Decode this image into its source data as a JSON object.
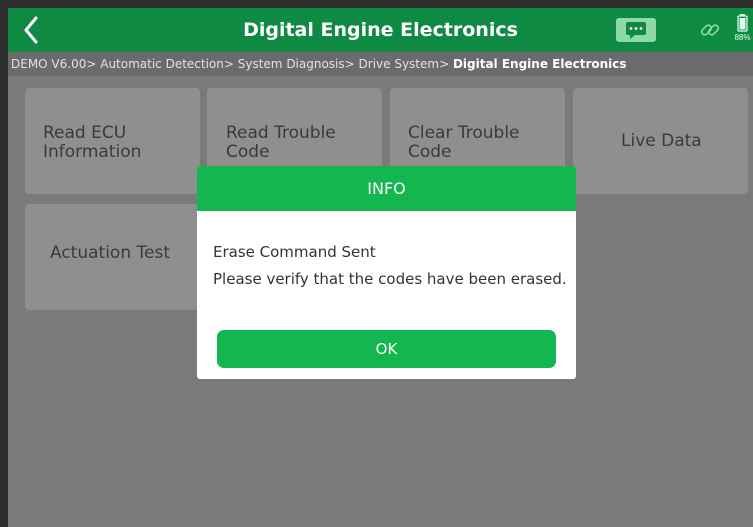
{
  "header": {
    "title": "Digital Engine Electronics",
    "back_icon": "chevron-left-icon",
    "message_icon": "message-icon",
    "link_icon": "link-icon",
    "battery_icon": "battery-icon",
    "battery_percent": "88%"
  },
  "breadcrumb": {
    "path": "DEMO V6.00> Automatic Detection> System Diagnosis> Drive System> ",
    "current": "Digital Engine Electronics"
  },
  "menu": {
    "read_ecu": {
      "line1": "Read ECU",
      "line2": "Information"
    },
    "read_codes": {
      "line1": "Read Trouble",
      "line2": "Code"
    },
    "clear_codes": {
      "line1": "Clear Trouble",
      "line2": "Code"
    },
    "live_data": "Live Data",
    "actuation_test": "Actuation Test"
  },
  "dialog": {
    "title": "INFO",
    "line1": "Erase Command Sent",
    "line2": "Please verify that the codes have been erased.",
    "ok_label": "OK"
  },
  "colors": {
    "header_green": "#0f8a43",
    "dialog_green": "#14b64f"
  }
}
